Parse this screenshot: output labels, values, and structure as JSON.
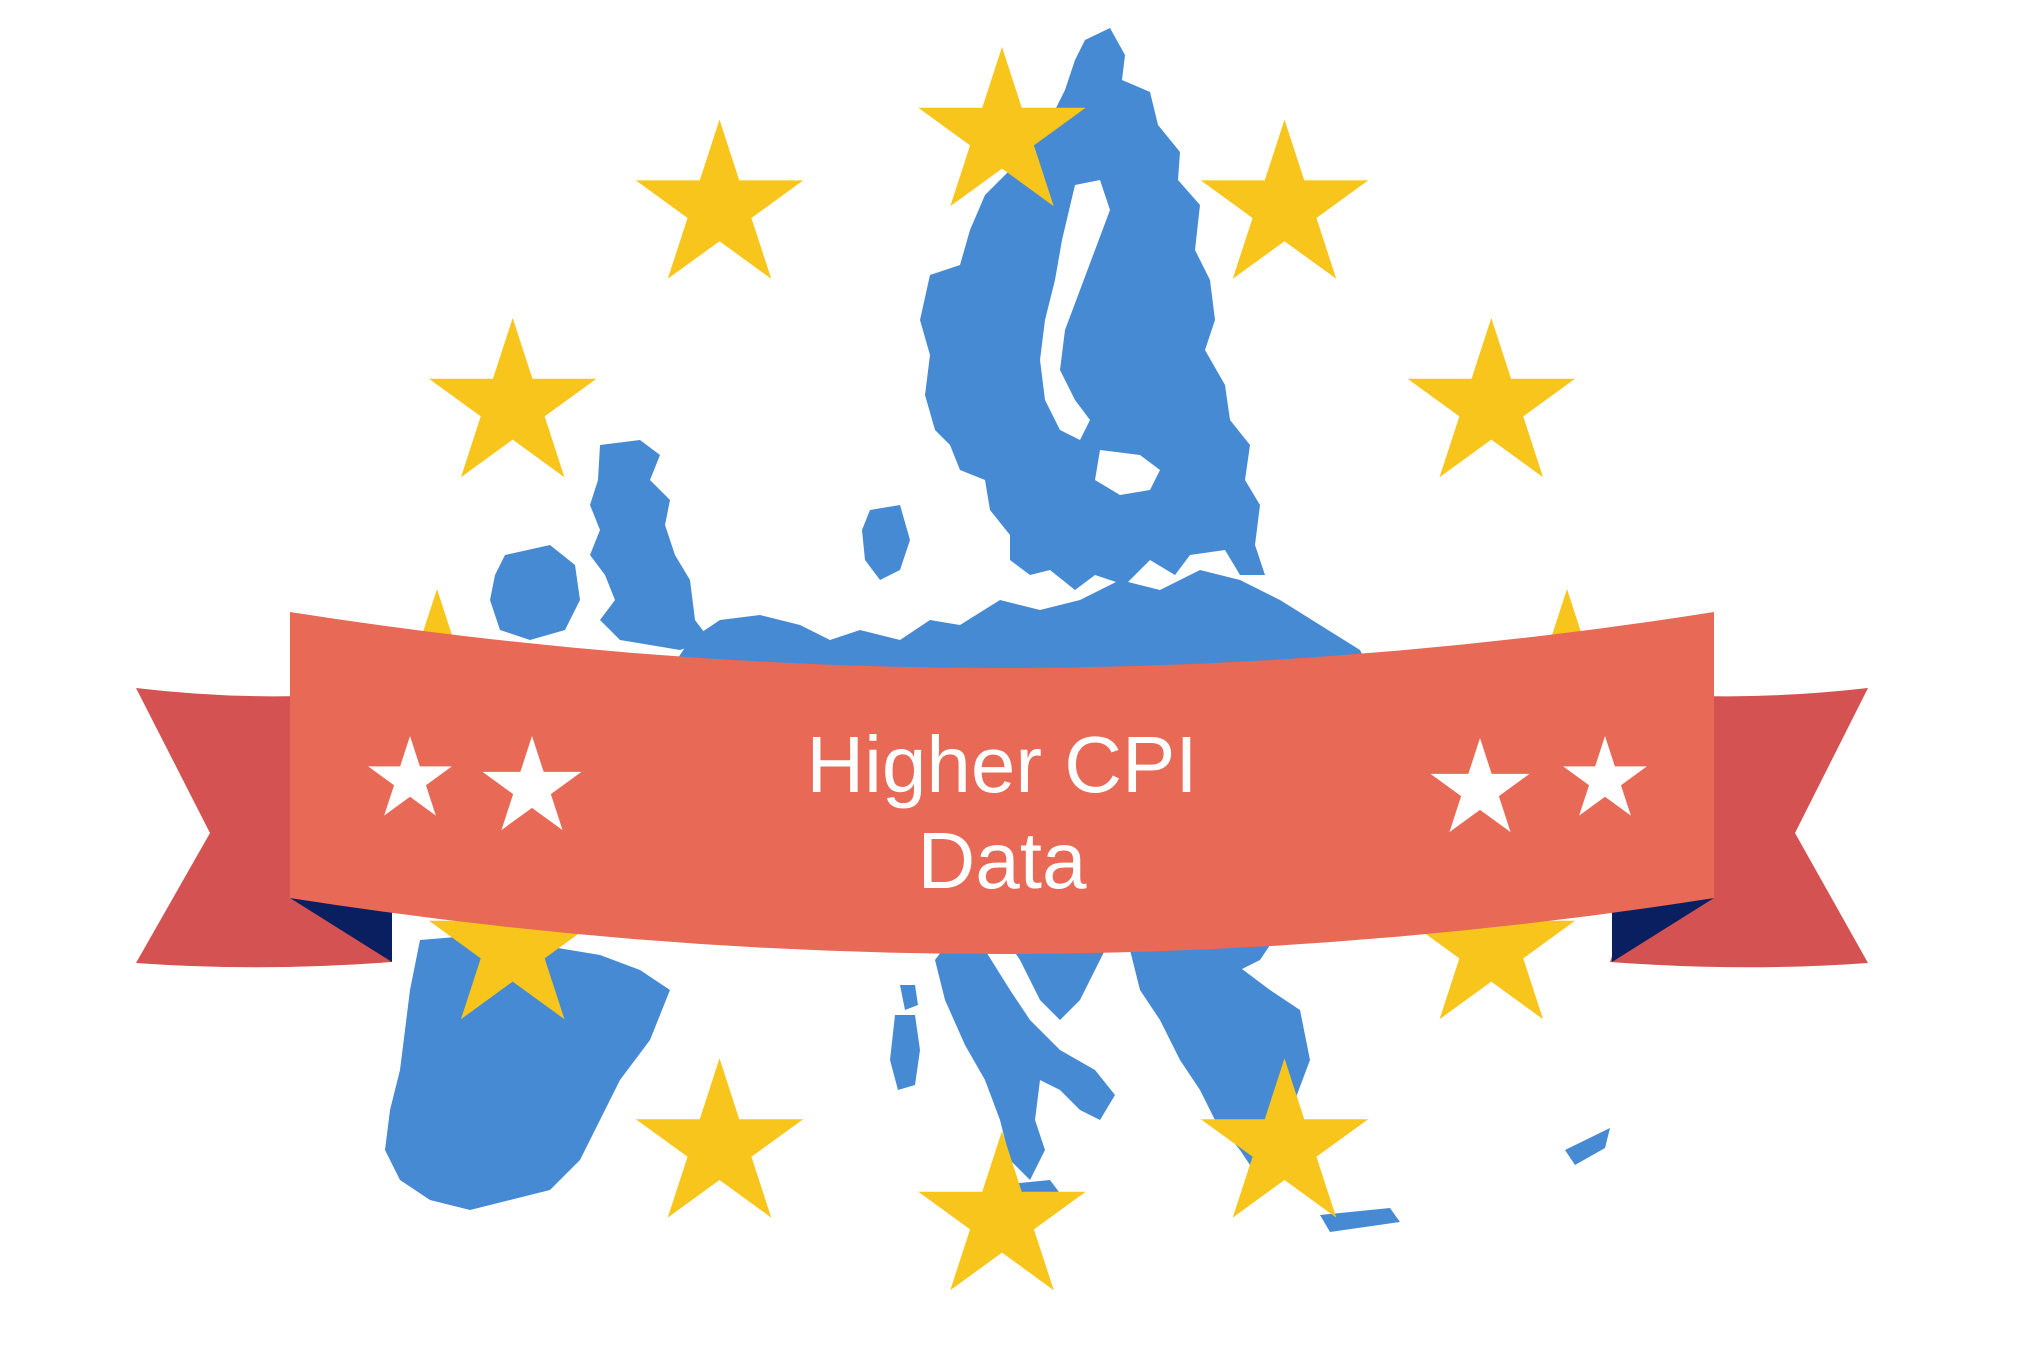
{
  "banner": {
    "line1": "Higher CPI",
    "line2": "Data"
  },
  "colors": {
    "map": "#458AD2",
    "eu_star": "#F8C51C",
    "banner_front": "#E76956",
    "banner_tail": "#D45251",
    "banner_fold": "#0A1F60",
    "banner_star": "#FFFFFF",
    "banner_text": "#FFFFFF",
    "background": "#FFFFFF"
  },
  "eu_star_count": 12,
  "banner_star_count": 4,
  "icons": {
    "map": "europe-map-icon",
    "eu_star": "eu-star-icon",
    "banner_star": "white-star-icon"
  }
}
